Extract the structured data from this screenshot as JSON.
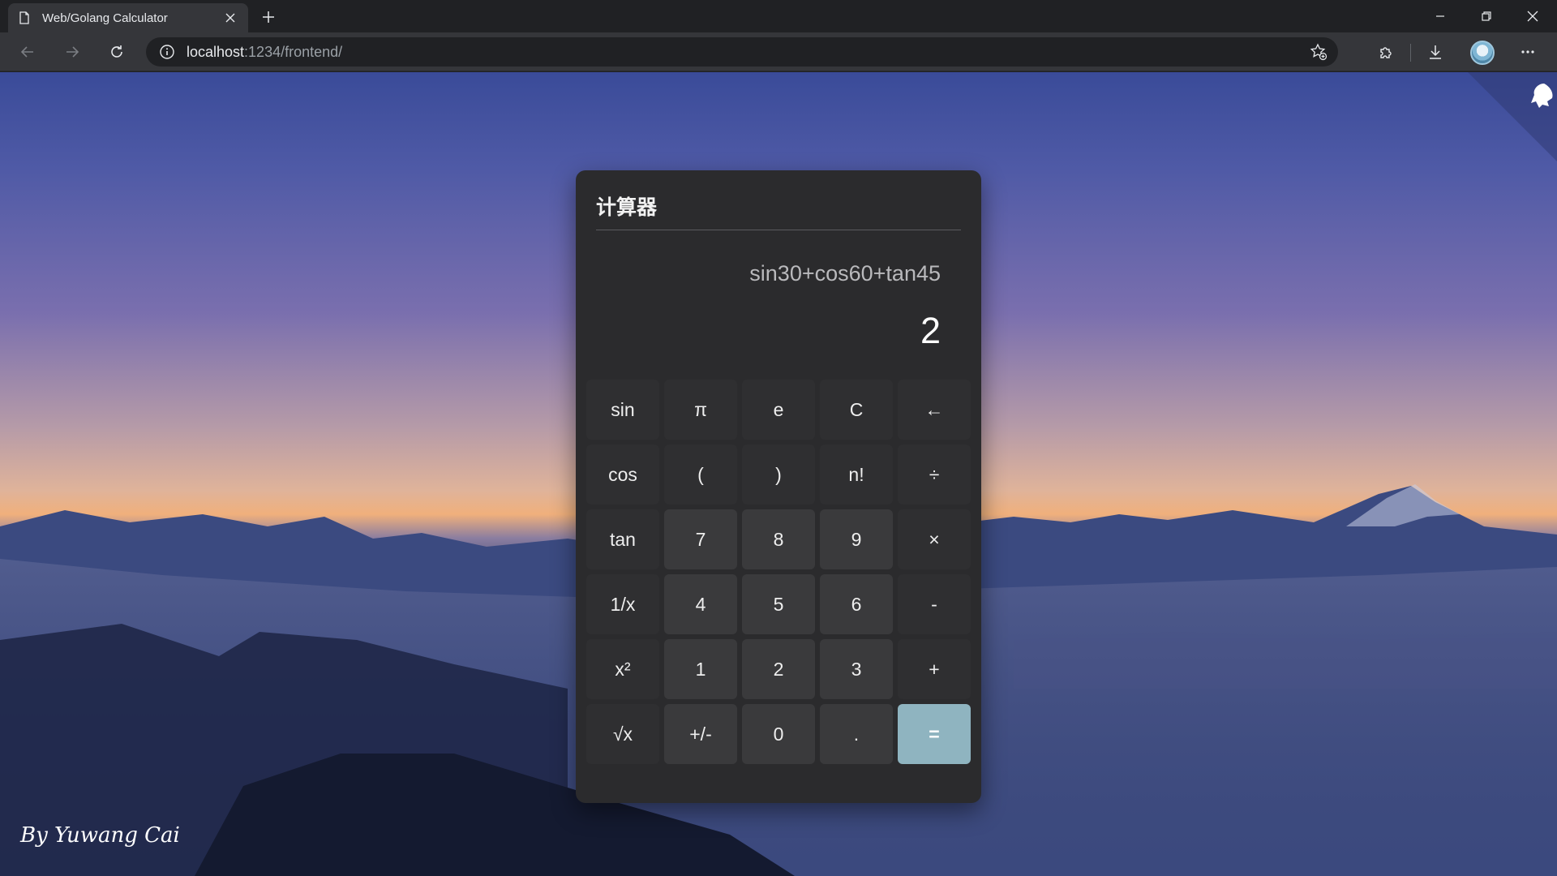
{
  "browser": {
    "tab_title": "Web/Golang Calculator",
    "url_host": "localhost",
    "url_rest": ":1234/frontend/",
    "icons": {
      "page": "page-icon",
      "tab_close": "close-icon",
      "new_tab": "plus-icon",
      "back": "back-arrow-icon",
      "forward": "forward-arrow-icon",
      "reload": "reload-icon",
      "site_info": "info-icon",
      "favorite": "star-add-icon",
      "extensions": "puzzle-icon",
      "downloads": "download-icon",
      "menu": "more-icon",
      "minimize": "minimize-icon",
      "maximize": "restore-icon",
      "close": "close-icon"
    }
  },
  "calculator": {
    "title": "计算器",
    "expression": "sin30+cos60+tan45",
    "result": "2",
    "keys": [
      {
        "label": "sin",
        "kind": "fn"
      },
      {
        "label": "π",
        "kind": "fn"
      },
      {
        "label": "e",
        "kind": "fn"
      },
      {
        "label": "C",
        "kind": "fn"
      },
      {
        "label": "←",
        "kind": "fn"
      },
      {
        "label": "cos",
        "kind": "fn"
      },
      {
        "label": "(",
        "kind": "fn"
      },
      {
        "label": ")",
        "kind": "fn"
      },
      {
        "label": "n!",
        "kind": "fn"
      },
      {
        "label": "÷",
        "kind": "op"
      },
      {
        "label": "tan",
        "kind": "fn"
      },
      {
        "label": "7",
        "kind": "num"
      },
      {
        "label": "8",
        "kind": "num"
      },
      {
        "label": "9",
        "kind": "num"
      },
      {
        "label": "×",
        "kind": "op"
      },
      {
        "label": "1/x",
        "kind": "fn"
      },
      {
        "label": "4",
        "kind": "num"
      },
      {
        "label": "5",
        "kind": "num"
      },
      {
        "label": "6",
        "kind": "num"
      },
      {
        "label": "-",
        "kind": "op"
      },
      {
        "label": "x²",
        "kind": "fn"
      },
      {
        "label": "1",
        "kind": "num"
      },
      {
        "label": "2",
        "kind": "num"
      },
      {
        "label": "3",
        "kind": "num"
      },
      {
        "label": "+",
        "kind": "op"
      },
      {
        "label": "√x",
        "kind": "fn"
      },
      {
        "label": "+/-",
        "kind": "num"
      },
      {
        "label": "0",
        "kind": "num"
      },
      {
        "label": ".",
        "kind": "num"
      },
      {
        "label": "=",
        "kind": "eq"
      }
    ]
  },
  "credit": "By Yuwang Cai",
  "colors": {
    "accent_equals": "#8fb4c0",
    "panel": "#2b2b2d"
  }
}
